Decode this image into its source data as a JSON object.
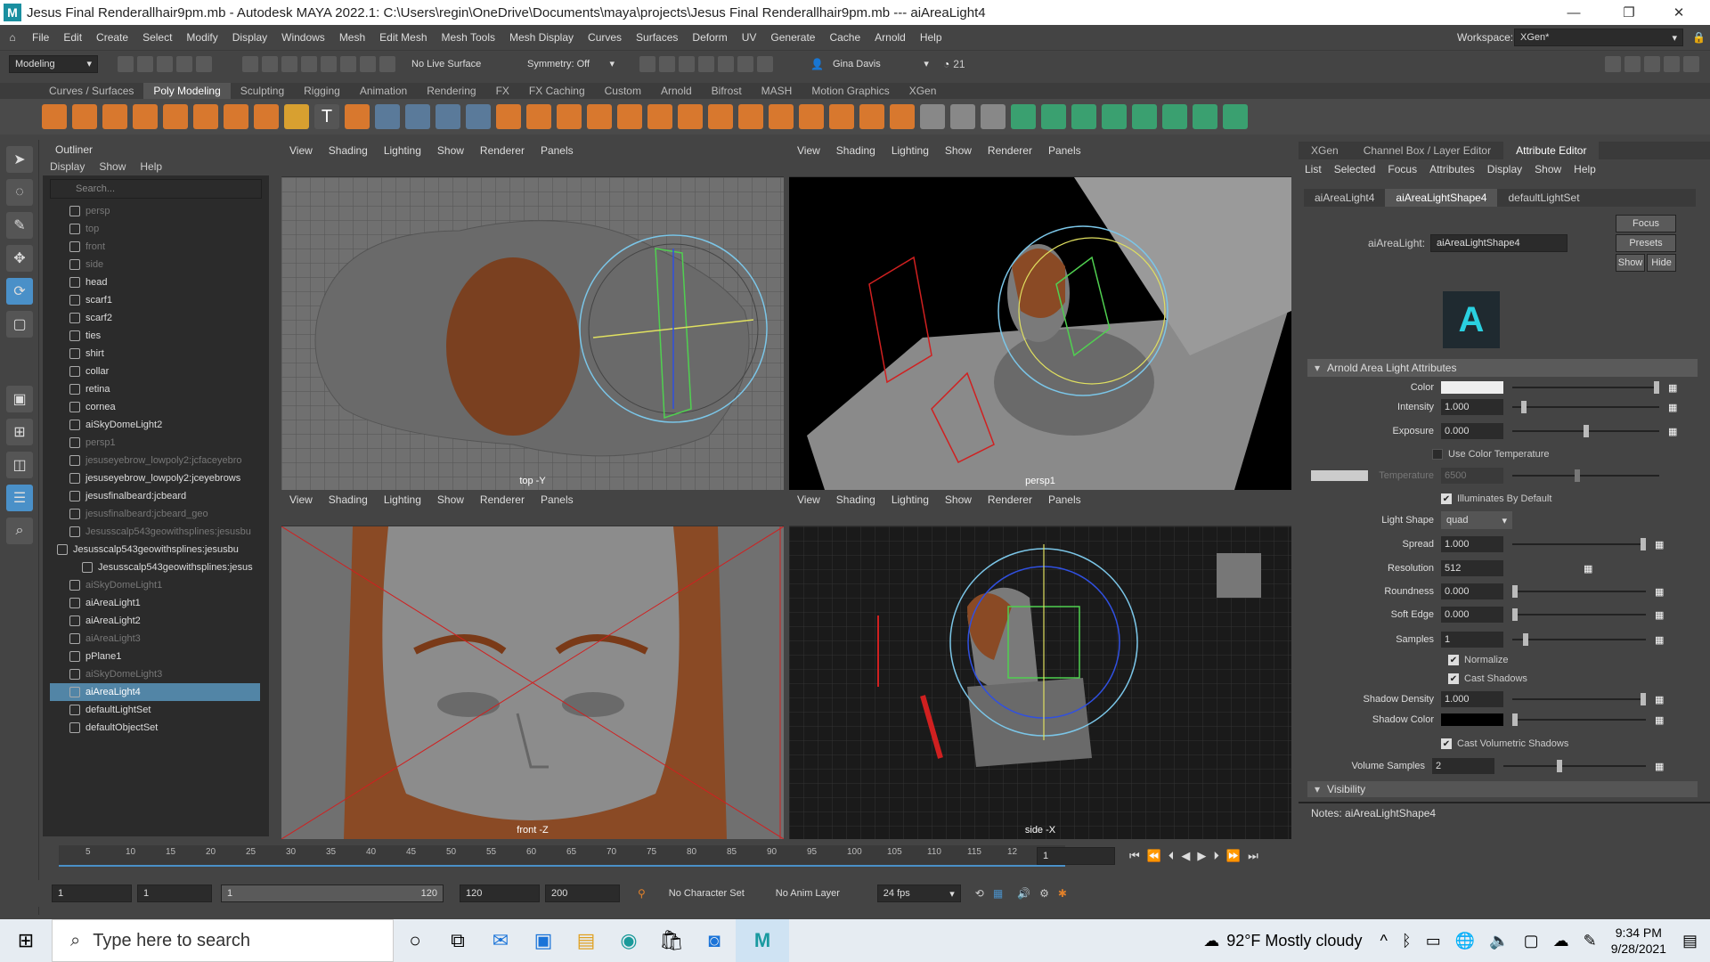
{
  "titlebar": {
    "title": "Jesus Final Renderallhair9pm.mb - Autodesk MAYA 2022.1: C:\\Users\\regin\\OneDrive\\Documents\\maya\\projects\\Jesus Final Renderallhair9pm.mb  ---  aiAreaLight4",
    "logo": "M",
    "minimize": "—",
    "restore": "❐",
    "close": "✕"
  },
  "menubar": {
    "items": [
      "File",
      "Edit",
      "Create",
      "Select",
      "Modify",
      "Display",
      "Windows",
      "Mesh",
      "Edit Mesh",
      "Mesh Tools",
      "Mesh Display",
      "Curves",
      "Surfaces",
      "Deform",
      "UV",
      "Generate",
      "Cache",
      "Arnold",
      "Help"
    ],
    "workspace_label": "Workspace:",
    "workspace_value": "XGen*"
  },
  "statusline": {
    "mode": "Modeling",
    "live_surface": "No Live Surface",
    "symmetry": "Symmetry: Off",
    "user": "Gina Davis",
    "timer_value": "21"
  },
  "shelf_tabs": [
    "Curves / Surfaces",
    "Poly Modeling",
    "Sculpting",
    "Rigging",
    "Animation",
    "Rendering",
    "FX",
    "FX Caching",
    "Custom",
    "Arnold",
    "Bifrost",
    "MASH",
    "Motion Graphics",
    "XGen"
  ],
  "shelf_active": "Poly Modeling",
  "outliner": {
    "title": "Outliner",
    "menu": [
      "Display",
      "Show",
      "Help"
    ],
    "search_placeholder": "Search...",
    "rows": [
      {
        "label": "persp",
        "dim": true,
        "indent": 1
      },
      {
        "label": "top",
        "dim": true,
        "indent": 1
      },
      {
        "label": "front",
        "dim": true,
        "indent": 1
      },
      {
        "label": "side",
        "dim": true,
        "indent": 1
      },
      {
        "label": "head",
        "dim": false,
        "indent": 1
      },
      {
        "label": "scarf1",
        "dim": false,
        "indent": 1
      },
      {
        "label": "scarf2",
        "dim": false,
        "indent": 1
      },
      {
        "label": "ties",
        "dim": false,
        "indent": 1
      },
      {
        "label": "shirt",
        "dim": false,
        "indent": 1
      },
      {
        "label": "collar",
        "dim": false,
        "indent": 1
      },
      {
        "label": "retina",
        "dim": false,
        "indent": 1
      },
      {
        "label": "cornea",
        "dim": false,
        "indent": 1
      },
      {
        "label": "aiSkyDomeLight2",
        "dim": false,
        "indent": 1
      },
      {
        "label": "persp1",
        "dim": true,
        "indent": 1
      },
      {
        "label": "jesuseyebrow_lowpoly2:jcfaceyebro",
        "dim": true,
        "indent": 1
      },
      {
        "label": "jesuseyebrow_lowpoly2:jceyebrows",
        "dim": false,
        "indent": 1
      },
      {
        "label": "jesusfinalbeard:jcbeard",
        "dim": false,
        "indent": 1
      },
      {
        "label": "jesusfinalbeard:jcbeard_geo",
        "dim": true,
        "indent": 1
      },
      {
        "label": "Jesusscalp543geowithsplines:jesusbu",
        "dim": true,
        "indent": 1
      },
      {
        "label": "Jesusscalp543geowithsplines:jesusbu",
        "dim": false,
        "indent": 0
      },
      {
        "label": "Jesusscalp543geowithsplines:jesus",
        "dim": false,
        "indent": 2
      },
      {
        "label": "aiSkyDomeLight1",
        "dim": true,
        "indent": 1
      },
      {
        "label": "aiAreaLight1",
        "dim": false,
        "indent": 1
      },
      {
        "label": "aiAreaLight2",
        "dim": false,
        "indent": 1
      },
      {
        "label": "aiAreaLight3",
        "dim": true,
        "indent": 1
      },
      {
        "label": "pPlane1",
        "dim": false,
        "indent": 1
      },
      {
        "label": "aiSkyDomeLight3",
        "dim": true,
        "indent": 1
      },
      {
        "label": "aiAreaLight4",
        "dim": false,
        "indent": 1,
        "selected": true
      },
      {
        "label": "defaultLightSet",
        "dim": false,
        "indent": 1
      },
      {
        "label": "defaultObjectSet",
        "dim": false,
        "indent": 1
      }
    ]
  },
  "viewport_menu": [
    "View",
    "Shading",
    "Lighting",
    "Show",
    "Renderer",
    "Panels"
  ],
  "viewports": {
    "top_left": "top -Y",
    "top_right": "persp1",
    "bottom_left": "front -Z",
    "bottom_right": "side -X"
  },
  "attribute_editor": {
    "tabs": [
      "XGen",
      "Channel Box / Layer Editor",
      "Attribute Editor"
    ],
    "active_tab": "Attribute Editor",
    "menu": [
      "List",
      "Selected",
      "Focus",
      "Attributes",
      "Display",
      "Show",
      "Help"
    ],
    "node_tabs": [
      "aiAreaLight4",
      "aiAreaLightShape4",
      "defaultLightSet"
    ],
    "node_label": "aiAreaLight:",
    "node_value": "aiAreaLightShape4",
    "focus_button": "Focus",
    "presets_button": "Presets",
    "show_button": "Show",
    "hide_button": "Hide",
    "section_title": "Arnold Area Light Attributes",
    "color_label": "Color",
    "intensity_label": "Intensity",
    "intensity_value": "1.000",
    "exposure_label": "Exposure",
    "exposure_value": "0.000",
    "use_color_temp_label": "Use Color Temperature",
    "temperature_label": "Temperature",
    "temperature_value": "6500",
    "illuminates_label": "Illuminates By Default",
    "light_shape_label": "Light Shape",
    "light_shape_value": "quad",
    "spread_label": "Spread",
    "spread_value": "1.000",
    "resolution_label": "Resolution",
    "resolution_value": "512",
    "roundness_label": "Roundness",
    "roundness_value": "0.000",
    "soft_edge_label": "Soft Edge",
    "soft_edge_value": "0.000",
    "samples_label": "Samples",
    "samples_value": "1",
    "normalize_label": "Normalize",
    "cast_shadows_label": "Cast Shadows",
    "shadow_density_label": "Shadow Density",
    "shadow_density_value": "1.000",
    "shadow_color_label": "Shadow Color",
    "cast_vol_shadows_label": "Cast Volumetric Shadows",
    "volume_samples_label": "Volume Samples",
    "volume_samples_value": "2",
    "visibility_title": "Visibility",
    "notes_label": "Notes:  aiAreaLightShape4"
  },
  "timeline": {
    "ticks": [
      "5",
      "10",
      "15",
      "20",
      "25",
      "30",
      "35",
      "40",
      "45",
      "50",
      "55",
      "60",
      "65",
      "70",
      "75",
      "80",
      "85",
      "90",
      "95",
      "100",
      "105",
      "110",
      "115",
      "12"
    ],
    "current_frame": "1"
  },
  "range": {
    "start": "1",
    "start2": "1",
    "range_start": "1",
    "range_end": "120",
    "end": "120",
    "end2": "200",
    "character_set": "No Character Set",
    "anim_layer": "No Anim Layer",
    "fps": "24 fps"
  },
  "taskbar": {
    "search_placeholder": "Type here to search",
    "weather": "92°F  Mostly cloudy",
    "time": "9:34 PM",
    "date": "9/28/2021"
  }
}
